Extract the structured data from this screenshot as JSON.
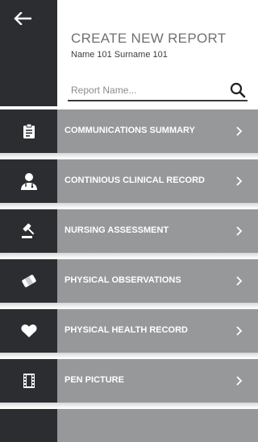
{
  "header": {
    "title": "CREATE NEW REPORT",
    "user_name": "Name 101 Surname 101"
  },
  "search": {
    "placeholder": "Report Name..."
  },
  "colors": {
    "sidebar_dark": "#2b2d30",
    "row_gray": "#97989a",
    "title_gray": "#6f7174",
    "label_white": "#ffffff"
  },
  "reports": [
    {
      "label": "COMMUNICATIONS SUMMARY",
      "icon": "clipboard-icon"
    },
    {
      "label": "CONTINIOUS CLINICAL RECORD",
      "icon": "doctor-icon"
    },
    {
      "label": "NURSING ASSESSMENT",
      "icon": "gavel-icon"
    },
    {
      "label": "PHYSICAL OBSERVATIONS",
      "icon": "bandage-icon"
    },
    {
      "label": "PHYSICAL HEALTH RECORD",
      "icon": "heart-icon"
    },
    {
      "label": "PEN PICTURE",
      "icon": "film-icon"
    }
  ]
}
